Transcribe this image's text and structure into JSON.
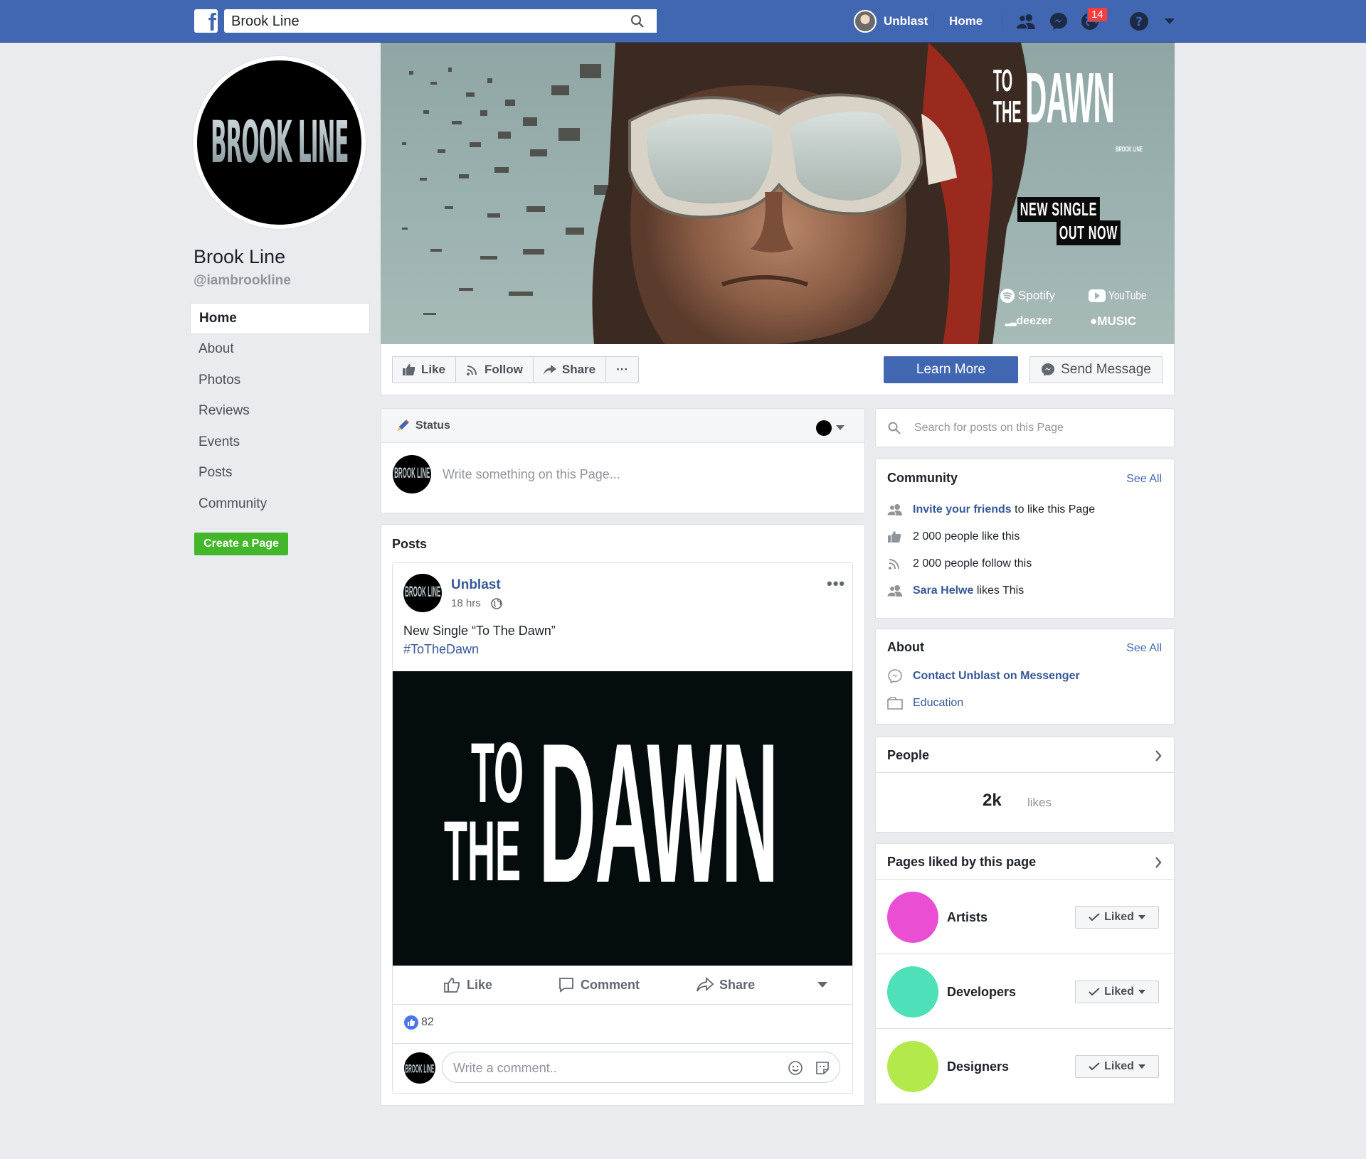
{
  "topbar": {
    "search_value": "Brook Line",
    "user_name": "Unblast",
    "home_label": "Home",
    "notif_count": "14"
  },
  "profile": {
    "logo_text": "BROOK LINE",
    "name": "Brook Line",
    "handle": "@iambrookline"
  },
  "leftnav": [
    "Home",
    "About",
    "Photos",
    "Reviews",
    "Events",
    "Posts",
    "Community"
  ],
  "create_page": "Create a Page",
  "cover": {
    "title_to": "TO",
    "title_the": "THE",
    "title_dawn": "DAWN",
    "brand_small": "BROOK LINE",
    "line1": "NEW SINGLE",
    "line2": "OUT NOW",
    "spotify": "Spotify",
    "youtube": "YouTube",
    "deezer": "deezer",
    "music": "MUSIC"
  },
  "actions": {
    "like": "Like",
    "follow": "Follow",
    "share": "Share",
    "more": "···",
    "learn_more": "Learn More",
    "send_message": "Send Message"
  },
  "status": {
    "label": "Status",
    "placeholder": "Write something on this Page..."
  },
  "posts": {
    "heading": "Posts",
    "author": "Unblast",
    "time": "18 hrs",
    "text": "New Single “To The Dawn”",
    "hashtag": "#ToTheDawn",
    "image_to": "TO",
    "image_the": "THE",
    "image_dawn": "DAWN",
    "like": "Like",
    "comment": "Comment",
    "share": "Share",
    "reaction_count": "82",
    "comment_placeholder": "Write a comment.."
  },
  "right": {
    "search_placeholder": "Search for posts on this Page",
    "community_title": "Community",
    "see_all": "See All",
    "invite_link": "Invite your friends",
    "invite_rest": " to like this Page",
    "likes_text": "2 000 people like this",
    "follow_text": "2 000  people follow this",
    "friend_name": "Sara Helwe",
    "friend_rest": " likes This",
    "about_title": "About",
    "contact": "Contact Unblast on Messenger",
    "education": "Education",
    "people_title": "People",
    "people_count": "2k",
    "people_unit": "likes",
    "pages_title": "Pages liked by this page",
    "liked_label": "Liked",
    "pages": [
      {
        "name": "Artists",
        "color": "#e94ed3"
      },
      {
        "name": "Developers",
        "color": "#4ee0b8"
      },
      {
        "name": "Designers",
        "color": "#b3e94a"
      }
    ]
  },
  "colors": {
    "brand": "#4267b2",
    "link": "#365899",
    "green": "#42b72a"
  }
}
